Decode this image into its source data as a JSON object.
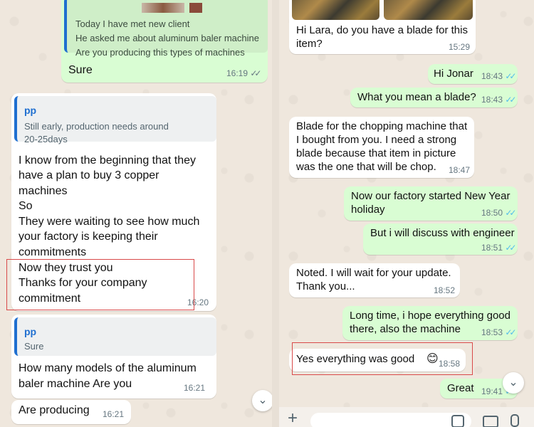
{
  "left": {
    "first_bubble": {
      "lines": [
        "Today I have met new client",
        "He asked me about aluminum baler machine",
        "Are you producing this types of machines"
      ],
      "text": "Sure",
      "time": "16:19"
    },
    "reply_bubble": {
      "quote_name": "pp",
      "quote_lines": [
        "Still early, production needs around",
        "20-25days"
      ],
      "lines": [
        "I know from the beginning that they",
        "have a plan to buy 3 copper",
        "machines",
        "So",
        "They were waiting to see how much",
        "your factory is keeping their",
        "commitments",
        "Now they trust you",
        "Thanks for your company",
        "commitment"
      ],
      "time": "16:20"
    },
    "reply_bubble_2": {
      "quote_name": "pp",
      "quote_text": "Sure",
      "lines": [
        "How many models of the aluminum",
        "baler machine Are you"
      ],
      "time": "16:21"
    },
    "last_bubble": {
      "text": "Are producing",
      "time": "16:21"
    }
  },
  "right": {
    "msg1": {
      "lines": [
        "Hi Lara, do you have a blade for this",
        "item?"
      ],
      "time": "15:29"
    },
    "msg2": {
      "text": "Hi Jonar",
      "time": "18:43"
    },
    "msg3": {
      "text": "What you mean a blade?",
      "time": "18:43"
    },
    "msg4": {
      "lines": [
        "Blade for the chopping machine that",
        "I bought from you. I need a strong",
        "blade because that item in picture",
        "was the one that will be chop."
      ],
      "time": "18:47"
    },
    "msg5": {
      "lines": [
        "Now our factory started New Year",
        "holiday"
      ],
      "time": "18:50"
    },
    "msg6": {
      "text": "But i will discuss with engineer",
      "time": "18:51"
    },
    "msg7": {
      "lines": [
        "Noted. I will wait for your update.",
        "Thank you..."
      ],
      "time": "18:52"
    },
    "msg8": {
      "lines": [
        "Long time, i hope everything good",
        "there, also the machine"
      ],
      "time": "18:53"
    },
    "msg9": {
      "text": "Yes everything was good",
      "emoji": "😊",
      "time": "18:58"
    },
    "msg10": {
      "text": "Great",
      "time": "19:41"
    }
  },
  "icons": {
    "scroll_down": "chevron-down-icon",
    "plus": "plus-icon",
    "sticker": "sticker-icon",
    "camera": "camera-icon",
    "mic": "mic-icon"
  },
  "colors": {
    "outgoing": "#d9fdd3",
    "incoming": "#ffffff",
    "read_ticks": "#53bdeb",
    "quote_bar": "#1f6fd0",
    "highlight": "#d94a4a"
  }
}
